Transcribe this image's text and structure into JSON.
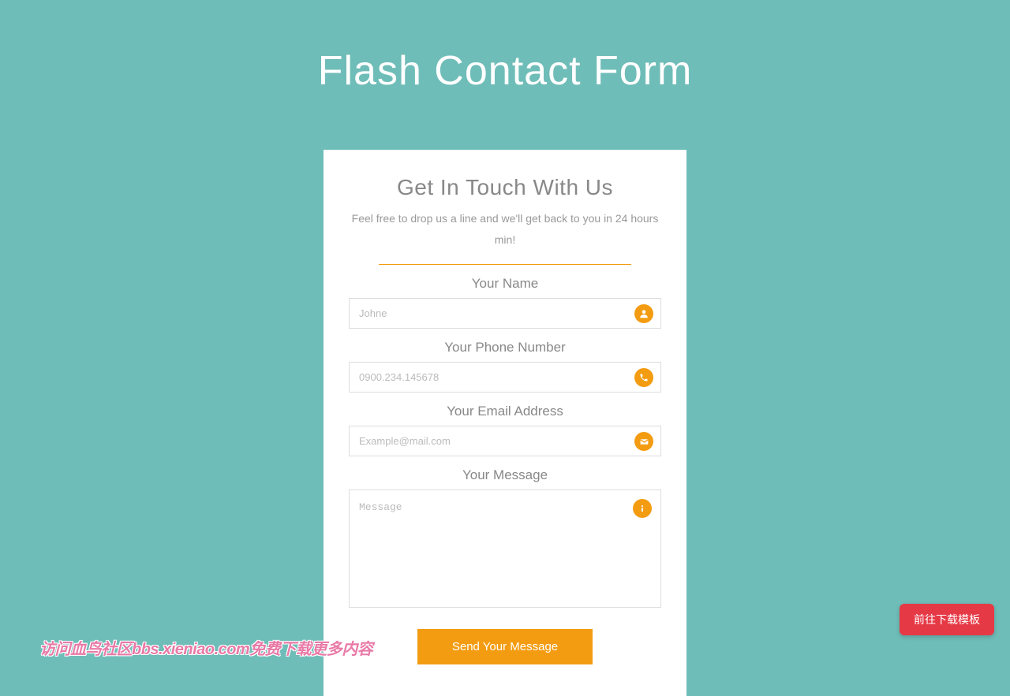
{
  "page": {
    "title": "Flash Contact Form"
  },
  "card": {
    "title": "Get In Touch With Us",
    "subtitle": "Feel free to drop us a line and we'll get back to you in 24 hours min!"
  },
  "form": {
    "name": {
      "label": "Your Name",
      "placeholder": "Johne",
      "value": ""
    },
    "phone": {
      "label": "Your Phone Number",
      "placeholder": "0900.234.145678",
      "value": ""
    },
    "email": {
      "label": "Your Email Address",
      "placeholder": "Example@mail.com",
      "value": ""
    },
    "message": {
      "label": "Your Message",
      "placeholder": "Message",
      "value": ""
    },
    "submit_label": "Send Your Message"
  },
  "corner_button": {
    "label": "前往下载模板"
  },
  "watermark": {
    "text": "访问血鸟社区bbs.xieniao.com免费下载更多内容"
  },
  "colors": {
    "accent": "#f39c12",
    "background": "#6fbdb8",
    "danger": "#e63946"
  }
}
